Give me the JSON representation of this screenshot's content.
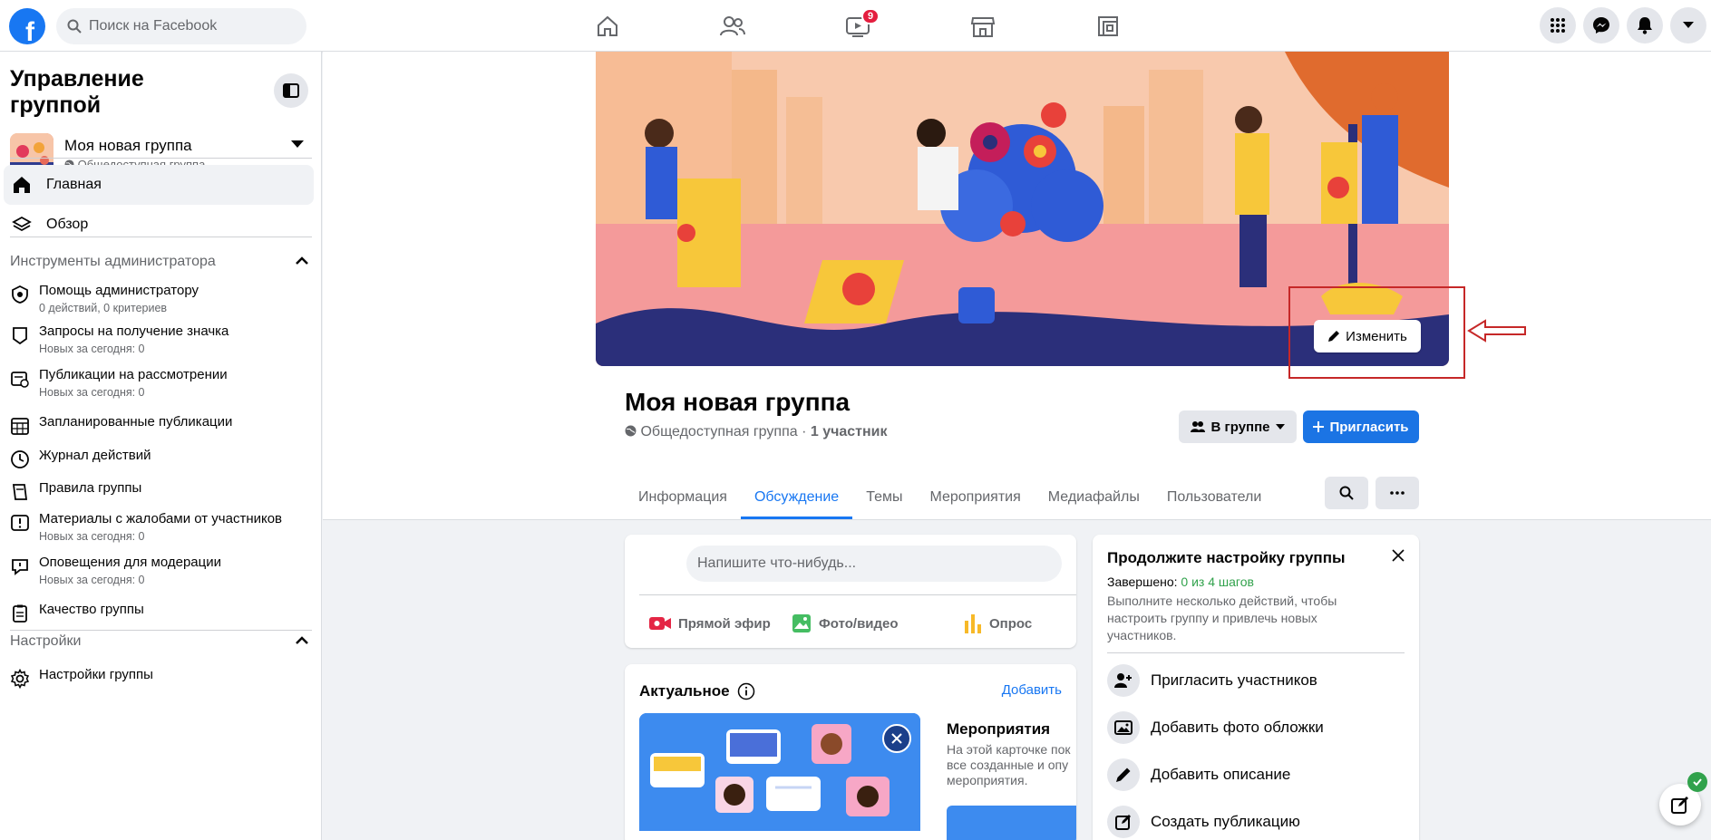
{
  "topbar": {
    "search_placeholder": "Поиск на Facebook",
    "video_badge": "9",
    "logo_letter": "f"
  },
  "sidebar": {
    "title": "Управление группой",
    "group": {
      "name": "Моя новая группа",
      "privacy": "Общедоступная группа"
    },
    "nav": [
      {
        "label": "Главная",
        "icon": "home-icon"
      },
      {
        "label": "Обзор",
        "icon": "layers-icon"
      }
    ],
    "admin_section": "Инструменты администратора",
    "tools": [
      {
        "label": "Помощь администратору",
        "sub": "0 действий, 0 критериев"
      },
      {
        "label": "Запросы на получение значка",
        "sub": "Новых за сегодня: 0"
      },
      {
        "label": "Публикации на рассмотрении",
        "sub": "Новых за сегодня: 0"
      },
      {
        "label": "Запланированные публикации",
        "sub": ""
      },
      {
        "label": "Журнал действий",
        "sub": ""
      },
      {
        "label": "Правила группы",
        "sub": ""
      },
      {
        "label": "Материалы с жалобами от участников",
        "sub": "Новых за сегодня: 0"
      },
      {
        "label": "Оповещения для модерации",
        "sub": "Новых за сегодня: 0"
      },
      {
        "label": "Качество группы",
        "sub": ""
      }
    ],
    "settings_section": "Настройки",
    "settings": [
      {
        "label": "Настройки группы"
      }
    ]
  },
  "header": {
    "edit_cover": "Изменить",
    "group_title": "Моя новая группа",
    "privacy": "Общедоступная группа",
    "separator": " · ",
    "members": "1 участник",
    "in_group_button": "В группе",
    "invite_button": "Пригласить",
    "tabs": [
      "Информация",
      "Обсуждение",
      "Темы",
      "Мероприятия",
      "Медиафайлы",
      "Пользователи"
    ]
  },
  "composer": {
    "placeholder": "Напишите что-нибудь...",
    "actions": [
      "Прямой эфир",
      "Фото/видео",
      "Опрос"
    ]
  },
  "featured": {
    "title": "Актуальное",
    "add": "Добавить",
    "events_title": "Мероприятия",
    "events_text": "На этой карточке пок\nвсе созданные и опу\nмероприятия."
  },
  "setup": {
    "title": "Продолжите настройку группы",
    "done_label": "Завершено:",
    "done_value": "0 из 4 шагов",
    "desc": "Выполните несколько действий, чтобы настроить группу и привлечь новых участников.",
    "steps": [
      "Пригласить участников",
      "Добавить фото обложки",
      "Добавить описание",
      "Создать публикацию"
    ]
  },
  "colors": {
    "accent": "#1877f2",
    "success": "#31a24c",
    "annotation": "#c62828"
  }
}
